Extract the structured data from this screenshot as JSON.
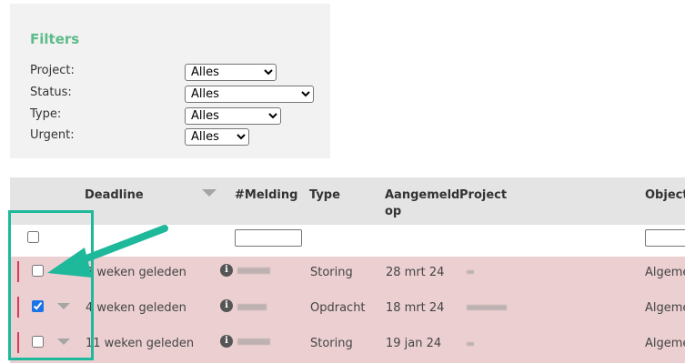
{
  "filters": {
    "title": "Filters",
    "fields": [
      {
        "label": "Project:",
        "value": "Alles"
      },
      {
        "label": "Status:",
        "value": "Alles"
      },
      {
        "label": "Type:",
        "value": "Alles"
      },
      {
        "label": "Urgent:",
        "value": "Alles"
      }
    ]
  },
  "table": {
    "columns": {
      "deadline": "Deadline",
      "melding": "#Melding",
      "type": "Type",
      "aangemeld": "Aangemeld op",
      "project": "Project",
      "objectgroep": "Objectg"
    },
    "rows": [
      {
        "deadline": "3 weken geleden",
        "type": "Storing",
        "aangemeld": "28 mrt 24",
        "objectgroep": "Algeme",
        "checked": false
      },
      {
        "deadline": "4 weken geleden",
        "type": "Opdracht",
        "aangemeld": "18 mrt 24",
        "objectgroep": "Algeme",
        "checked": true
      },
      {
        "deadline": "11 weken geleden",
        "type": "Storing",
        "aangemeld": "19 jan 24",
        "objectgroep": "Algeme",
        "checked": false
      }
    ]
  },
  "icons": {
    "info": "info-icon",
    "sort": "sort-down-icon",
    "expand": "chevron-down-icon",
    "info_glyph": "i"
  },
  "colors": {
    "accent_green": "#5dbb8a",
    "annotation_teal": "#1eb89b",
    "row_bg": "#ebcfd1",
    "urgent_marker": "#d63b5c"
  }
}
